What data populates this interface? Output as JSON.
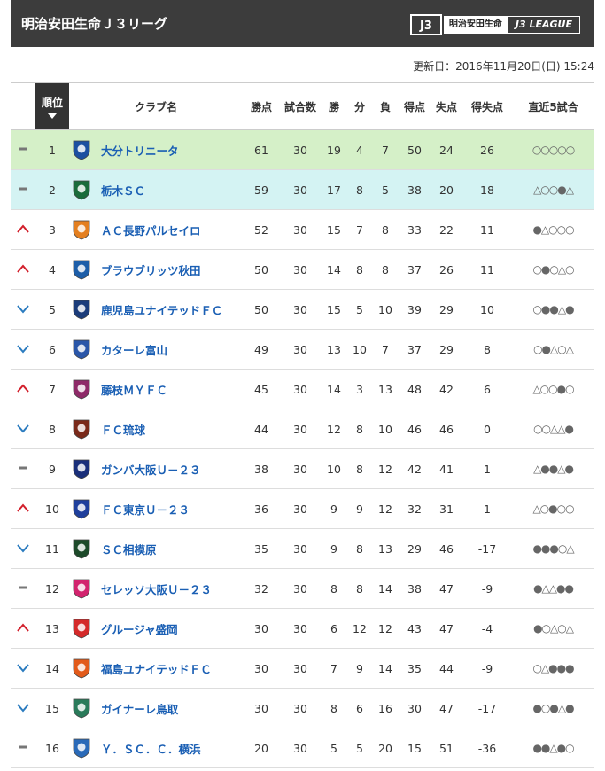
{
  "header": {
    "title": "明治安田生命Ｊ３リーグ",
    "sponsor": "明治安田生命",
    "league": "J3 LEAGUE"
  },
  "updated": "更新日：2016年11月20日(日) 15:24",
  "columns": {
    "rank": "順位",
    "club": "クラブ名",
    "points": "勝点",
    "played": "試合数",
    "won": "勝",
    "drawn": "分",
    "lost": "負",
    "gf": "得点",
    "ga": "失点",
    "gd": "得失点",
    "recent": "直近5試合"
  },
  "colors": {
    "champion_row": "#d5f0c8",
    "promotion_row": "#d4f3f3",
    "up": "#d21f2b",
    "down": "#2a7bbf",
    "link": "#1a5fb4"
  },
  "rows": [
    {
      "movement": "same",
      "rank": "1",
      "club": "大分トリニータ",
      "crest": "#1c4fa0",
      "points": "61",
      "played": "30",
      "won": "19",
      "drawn": "4",
      "lost": "7",
      "gf": "50",
      "ga": "24",
      "gd": "26",
      "recent": "○○○○○"
    },
    {
      "movement": "same",
      "rank": "2",
      "club": "栃木ＳＣ",
      "crest": "#1a6b3a",
      "points": "59",
      "played": "30",
      "won": "17",
      "drawn": "8",
      "lost": "5",
      "gf": "38",
      "ga": "20",
      "gd": "18",
      "recent": "△○○●△"
    },
    {
      "movement": "up",
      "rank": "3",
      "club": "ＡＣ長野パルセイロ",
      "crest": "#e47f1f",
      "points": "52",
      "played": "30",
      "won": "15",
      "drawn": "7",
      "lost": "8",
      "gf": "33",
      "ga": "22",
      "gd": "11",
      "recent": "●△○○○"
    },
    {
      "movement": "up",
      "rank": "4",
      "club": "ブラウブリッツ秋田",
      "crest": "#1d5ea8",
      "points": "50",
      "played": "30",
      "won": "14",
      "drawn": "8",
      "lost": "8",
      "gf": "37",
      "ga": "26",
      "gd": "11",
      "recent": "○●○△○"
    },
    {
      "movement": "down",
      "rank": "5",
      "club": "鹿児島ユナイテッドＦＣ",
      "crest": "#1b3c7a",
      "points": "50",
      "played": "30",
      "won": "15",
      "drawn": "5",
      "lost": "10",
      "gf": "39",
      "ga": "29",
      "gd": "10",
      "recent": "○●●△●"
    },
    {
      "movement": "down",
      "rank": "6",
      "club": "カターレ富山",
      "crest": "#2a56a8",
      "points": "49",
      "played": "30",
      "won": "13",
      "drawn": "10",
      "lost": "7",
      "gf": "37",
      "ga": "29",
      "gd": "8",
      "recent": "○●△○△"
    },
    {
      "movement": "up",
      "rank": "7",
      "club": "藤枝ＭＹＦＣ",
      "crest": "#8e2a68",
      "points": "45",
      "played": "30",
      "won": "14",
      "drawn": "3",
      "lost": "13",
      "gf": "48",
      "ga": "42",
      "gd": "6",
      "recent": "△○○●○"
    },
    {
      "movement": "down",
      "rank": "8",
      "club": "ＦＣ琉球",
      "crest": "#7a2a1a",
      "points": "44",
      "played": "30",
      "won": "12",
      "drawn": "8",
      "lost": "10",
      "gf": "46",
      "ga": "46",
      "gd": "0",
      "recent": "○○△△●"
    },
    {
      "movement": "same",
      "rank": "9",
      "club": "ガンバ大阪Ｕ－２３",
      "crest": "#1a2f7a",
      "points": "38",
      "played": "30",
      "won": "10",
      "drawn": "8",
      "lost": "12",
      "gf": "42",
      "ga": "41",
      "gd": "1",
      "recent": "△●●△●"
    },
    {
      "movement": "up",
      "rank": "10",
      "club": "ＦＣ東京Ｕ－２３",
      "crest": "#1f3f9c",
      "points": "36",
      "played": "30",
      "won": "9",
      "drawn": "9",
      "lost": "12",
      "gf": "32",
      "ga": "31",
      "gd": "1",
      "recent": "△○●○○"
    },
    {
      "movement": "down",
      "rank": "11",
      "club": "ＳＣ相模原",
      "crest": "#1d4a2a",
      "points": "35",
      "played": "30",
      "won": "9",
      "drawn": "8",
      "lost": "13",
      "gf": "29",
      "ga": "46",
      "gd": "-17",
      "recent": "●●●○△"
    },
    {
      "movement": "same",
      "rank": "12",
      "club": "セレッソ大阪Ｕ－２３",
      "crest": "#d2246e",
      "points": "32",
      "played": "30",
      "won": "8",
      "drawn": "8",
      "lost": "14",
      "gf": "38",
      "ga": "47",
      "gd": "-9",
      "recent": "●△△●●"
    },
    {
      "movement": "up",
      "rank": "13",
      "club": "グルージャ盛岡",
      "crest": "#d42a2a",
      "points": "30",
      "played": "30",
      "won": "6",
      "drawn": "12",
      "lost": "12",
      "gf": "43",
      "ga": "47",
      "gd": "-4",
      "recent": "●○△○△"
    },
    {
      "movement": "down",
      "rank": "14",
      "club": "福島ユナイテッドＦＣ",
      "crest": "#e25a1a",
      "points": "30",
      "played": "30",
      "won": "7",
      "drawn": "9",
      "lost": "14",
      "gf": "35",
      "ga": "44",
      "gd": "-9",
      "recent": "○△●●●"
    },
    {
      "movement": "down",
      "rank": "15",
      "club": "ガイナーレ鳥取",
      "crest": "#2a7a5a",
      "points": "30",
      "played": "30",
      "won": "8",
      "drawn": "6",
      "lost": "16",
      "gf": "30",
      "ga": "47",
      "gd": "-17",
      "recent": "●○●△●"
    },
    {
      "movement": "same",
      "rank": "16",
      "club": "Ｙ．ＳＣ．Ｃ．横浜",
      "crest": "#2a6ab8",
      "points": "20",
      "played": "30",
      "won": "5",
      "drawn": "5",
      "lost": "20",
      "gf": "15",
      "ga": "51",
      "gd": "-36",
      "recent": "●●△●○"
    }
  ]
}
